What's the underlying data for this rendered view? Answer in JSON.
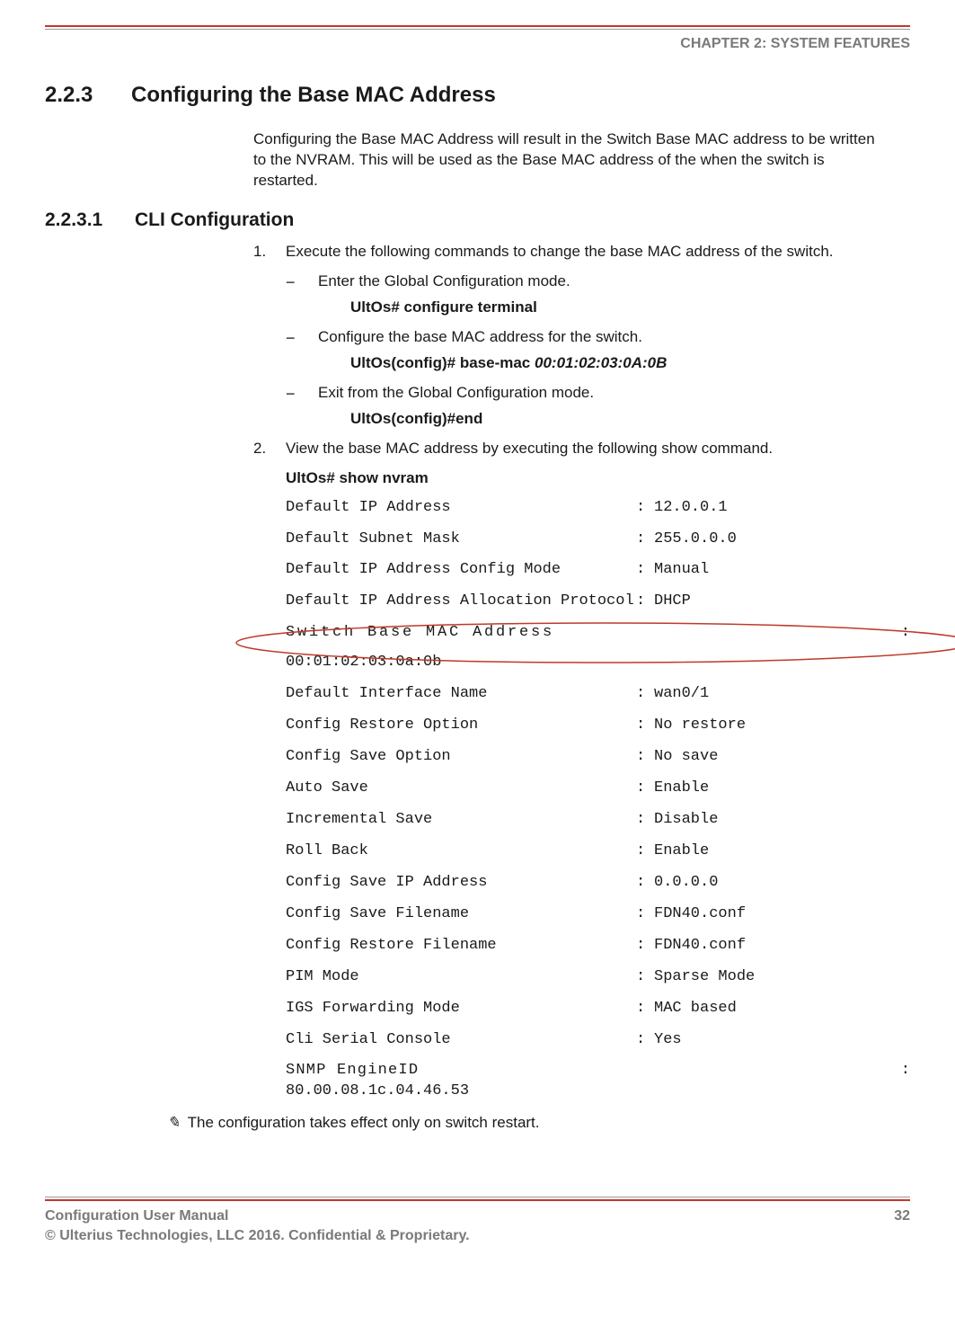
{
  "chapter": "CHAPTER 2: SYSTEM FEATURES",
  "section": {
    "num": "2.2.3",
    "title": "Configuring the Base MAC Address"
  },
  "intro": "Configuring the Base MAC Address will result in the Switch Base MAC address to be written to the NVRAM. This will be used as the Base MAC address of the when the switch is restarted.",
  "subsection": {
    "num": "2.2.3.1",
    "title": "CLI Configuration"
  },
  "steps": {
    "s1": {
      "num": "1.",
      "text": "Execute the following commands to change the base MAC address of the switch."
    },
    "s1a": {
      "dash": "−",
      "text": "Enter the Global Configuration mode.",
      "cmd": "UltOs# configure terminal"
    },
    "s1b": {
      "dash": "−",
      "text": "Configure the base MAC address for the switch.",
      "cmd_prefix": "UltOs(config)# base-mac ",
      "cmd_param": "00:01:02:03:0A:0B"
    },
    "s1c": {
      "dash": "−",
      "text": "Exit from the Global Configuration mode.",
      "cmd": "UltOs(config)#end"
    },
    "s2": {
      "num": "2.",
      "text": "View the base MAC address by executing the following show command."
    },
    "s2cmd": "UltOs# show nvram"
  },
  "output": {
    "rows": [
      {
        "label": "Default IP Address",
        "value": "12.0.0.1"
      },
      {
        "label": "Default Subnet Mask",
        "value": "255.0.0.0"
      },
      {
        "label": "Default IP Address Config Mode",
        "value": "Manual"
      },
      {
        "label": "Default IP Address Allocation Protocol",
        "value": "DHCP"
      }
    ],
    "highlight": {
      "label": "Switch Base MAC Address",
      "value": "00:01:02:03:0a:0b"
    },
    "rows2": [
      {
        "label": "Default Interface Name",
        "value": "wan0/1"
      },
      {
        "label": "Config Restore Option",
        "value": "No restore"
      },
      {
        "label": "Config Save Option",
        "value": "No save"
      },
      {
        "label": "Auto Save",
        "value": "Enable"
      },
      {
        "label": "Incremental Save",
        "value": "Disable"
      },
      {
        "label": "Roll Back",
        "value": "Enable"
      },
      {
        "label": "Config Save IP Address",
        "value": "0.0.0.0"
      },
      {
        "label": "Config Save Filename",
        "value": "FDN40.conf"
      },
      {
        "label": "Config Restore Filename",
        "value": "FDN40.conf"
      },
      {
        "label": "PIM Mode",
        "value": "Sparse Mode"
      },
      {
        "label": "IGS Forwarding Mode",
        "value": "MAC based"
      },
      {
        "label": "Cli Serial Console",
        "value": "Yes"
      }
    ],
    "wide": {
      "label": "SNMP EngineID",
      "value": "80.00.08.1c.04.46.53"
    }
  },
  "note_icon": "✎",
  "note": "The configuration takes effect only on switch restart.",
  "footer": {
    "left1": "Configuration User Manual",
    "left2": "© Ulterius Technologies, LLC 2016. Confidential & Proprietary.",
    "page": "32"
  },
  "colon": ":"
}
